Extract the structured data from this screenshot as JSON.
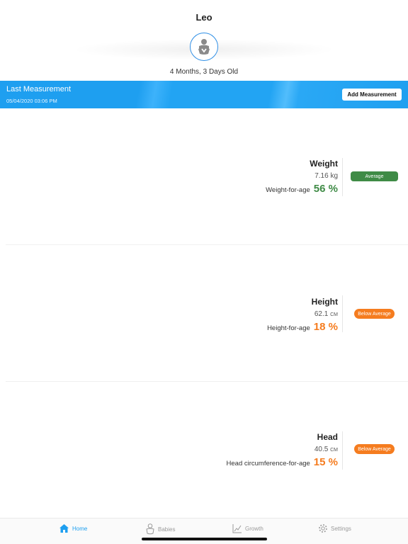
{
  "profile": {
    "name": "Leo",
    "age": "4 Months, 3 Days Old",
    "avatar_icon": "baby-icon"
  },
  "banner": {
    "title": "Last Measurement",
    "date": "05/04/2020 03:06 PM",
    "add_label": "Add Measurement"
  },
  "metrics": [
    {
      "title": "Weight",
      "value": "7.16",
      "unit": "kg",
      "percentile_label": "Weight-for-age",
      "percentile": "56 %",
      "status": "Average",
      "color": "#3f8b46"
    },
    {
      "title": "Height",
      "value": "62.1",
      "unit": "CM",
      "percentile_label": "Height-for-age",
      "percentile": "18 %",
      "status": "Below Average",
      "color": "#f57c1f"
    },
    {
      "title": "Head",
      "value": "40.5",
      "unit": "CM",
      "percentile_label": "Head circumference-for-age",
      "percentile": "15 %",
      "status": "Below Average",
      "color": "#f57c1f"
    }
  ],
  "tabs": [
    {
      "label": "Home",
      "icon": "home-icon",
      "active": true
    },
    {
      "label": "Babies",
      "icon": "baby-icon",
      "active": false
    },
    {
      "label": "Growth",
      "icon": "chart-icon",
      "active": false
    },
    {
      "label": "Settings",
      "icon": "gear-icon",
      "active": false
    }
  ],
  "colors": {
    "accent": "#1e9ff0",
    "average": "#3f8b46",
    "below_average": "#f57c1f",
    "tab_inactive": "#9a9a9a"
  }
}
